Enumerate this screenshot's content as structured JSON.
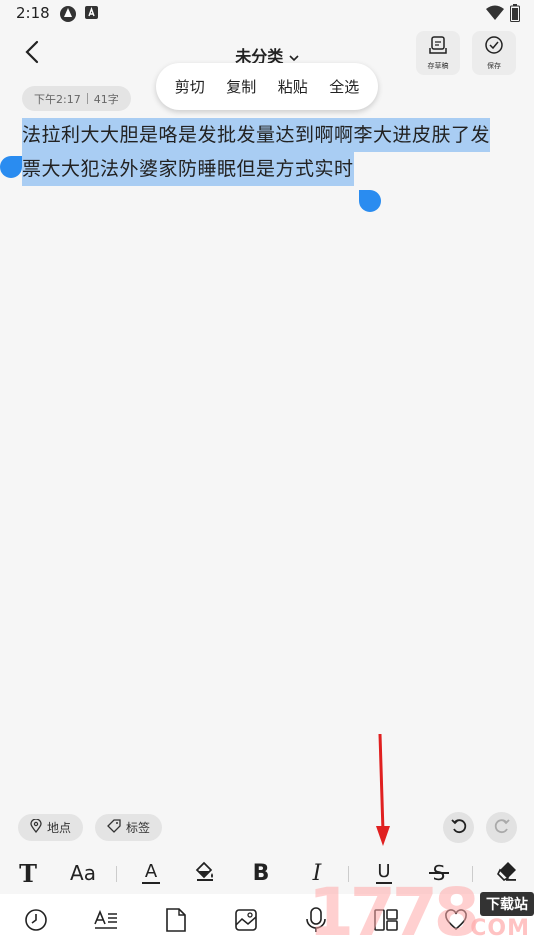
{
  "status_bar": {
    "time": "2:18"
  },
  "header": {
    "category": "未分类",
    "save_draft_label": "存草稿",
    "save_label": "保存"
  },
  "meta": {
    "time": "下午2:17",
    "count": "41字"
  },
  "context_menu": {
    "cut": "剪切",
    "copy": "复制",
    "paste": "粘贴",
    "select_all": "全选"
  },
  "editor": {
    "line1": "法拉利大大胆是咯是发批发量达到啊啊李大进皮肤了发",
    "line2": "票大大犯法外婆家防睡眠但是方式实时"
  },
  "chips": {
    "location": "地点",
    "tag": "标签"
  },
  "format_toolbar": {
    "text_icon": "T",
    "font_size_icon": "Aa",
    "font_color_icon": "A",
    "bold_icon": "B",
    "italic_icon": "I",
    "underline_icon": "U",
    "strike_icon": "S"
  },
  "watermark": {
    "digits": "1778",
    "site": "下载站",
    "com": "COM"
  },
  "colors": {
    "selection": "#a9cdf3",
    "handle": "#2a8cf0",
    "arrow": "#e02020"
  }
}
